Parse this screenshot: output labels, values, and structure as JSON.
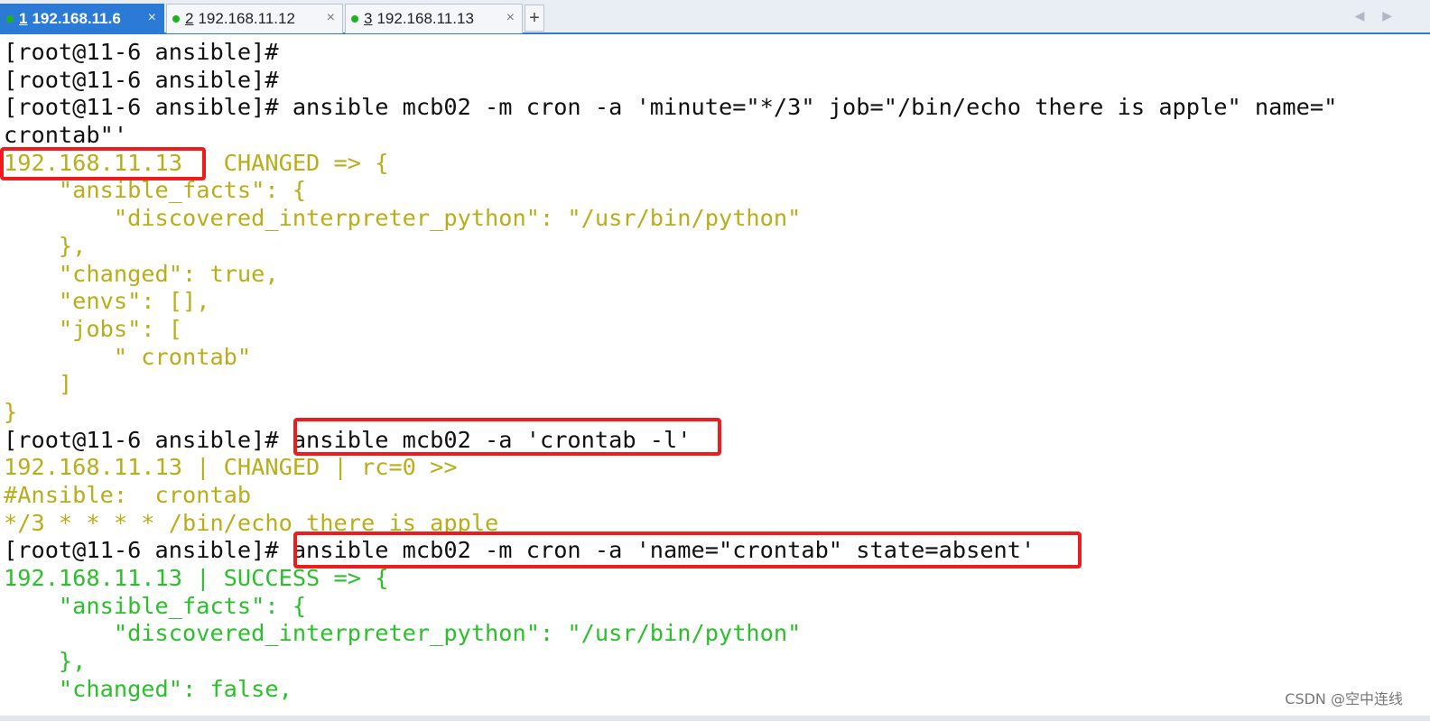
{
  "tabs": [
    {
      "num": "1",
      "label": "192.168.11.6",
      "active": true
    },
    {
      "num": "2",
      "label": "192.168.11.12",
      "active": false
    },
    {
      "num": "3",
      "label": "192.168.11.13",
      "active": false
    }
  ],
  "close_glyph": "×",
  "new_tab_glyph": "+",
  "nav_arrows": "◀ ▶",
  "terminal_lines": [
    {
      "text": "[root@11-6 ansible]#",
      "color": "black"
    },
    {
      "text": "[root@11-6 ansible]#",
      "color": "black"
    },
    {
      "text": "[root@11-6 ansible]# ansible mcb02 -m cron -a 'minute=\"*/3\" job=\"/bin/echo there is apple\" name=\"",
      "color": "black"
    },
    {
      "text": "crontab\"'",
      "color": "black"
    },
    {
      "text": "192.168.11.13 | CHANGED => {",
      "color": "yellow"
    },
    {
      "text": "    \"ansible_facts\": {",
      "color": "yellow"
    },
    {
      "text": "        \"discovered_interpreter_python\": \"/usr/bin/python\"",
      "color": "yellow"
    },
    {
      "text": "    },",
      "color": "yellow"
    },
    {
      "text": "    \"changed\": true,",
      "color": "yellow"
    },
    {
      "text": "    \"envs\": [],",
      "color": "yellow"
    },
    {
      "text": "    \"jobs\": [",
      "color": "yellow"
    },
    {
      "text": "        \" crontab\"",
      "color": "yellow"
    },
    {
      "text": "    ]",
      "color": "yellow"
    },
    {
      "text": "}",
      "color": "yellow"
    },
    {
      "text": "[root@11-6 ansible]# ansible mcb02 -a 'crontab -l'",
      "color": "black"
    },
    {
      "text": "192.168.11.13 | CHANGED | rc=0 >>",
      "color": "yellow"
    },
    {
      "text": "#Ansible:  crontab",
      "color": "yellow"
    },
    {
      "text": "*/3 * * * * /bin/echo there is apple",
      "color": "yellow"
    },
    {
      "text": "[root@11-6 ansible]# ansible mcb02 -m cron -a 'name=\"crontab\" state=absent'",
      "color": "black"
    },
    {
      "text": "192.168.11.13 | SUCCESS => {",
      "color": "green"
    },
    {
      "text": "    \"ansible_facts\": {",
      "color": "green"
    },
    {
      "text": "        \"discovered_interpreter_python\": \"/usr/bin/python\"",
      "color": "green"
    },
    {
      "text": "    },",
      "color": "green"
    },
    {
      "text": "    \"changed\": false,",
      "color": "green"
    }
  ],
  "watermark": "CSDN @空中连线",
  "colors": {
    "accent": "#2b7bd6",
    "highlight_box": "#ee1c1c",
    "yellow_text": "#b8ae1a",
    "green_text": "#2bc02b"
  }
}
